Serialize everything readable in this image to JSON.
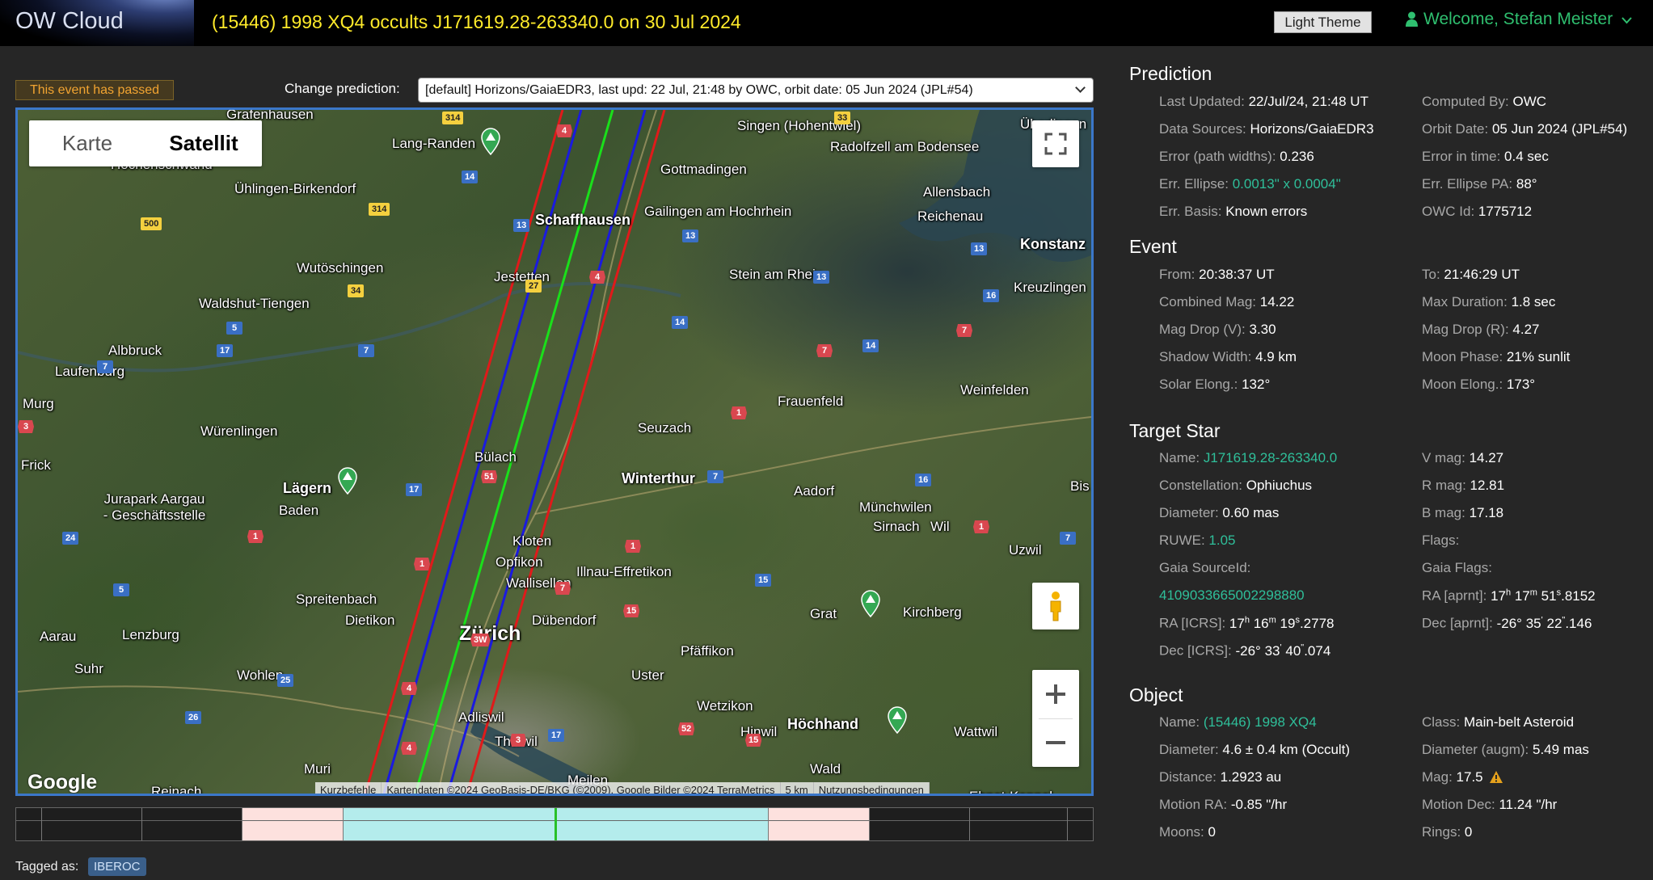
{
  "app": {
    "logo": "OW Cloud",
    "event_title": "(15446) 1998 XQ4 occults J171619.28-263340.0 on 30 Jul 2024",
    "theme_button": "Light Theme",
    "welcome": "Welcome, Stefan Meister"
  },
  "status": {
    "passed": "This event has passed"
  },
  "prediction_select": {
    "label": "Change prediction:",
    "value": "[default] Horizons/GaiaEDR3, last upd: 22 Jul, 21:48 by OWC, orbit date: 05 Jun 2024 (JPL#54)"
  },
  "map": {
    "type_options": [
      "Karte",
      "Satellit"
    ],
    "active_type": "Satellit",
    "google": "Google",
    "attribution": [
      "Kurzbefehle",
      "Kartendaten ©2024 GeoBasis-DE/BKG (©2009), Google Bilder ©2024 TerraMetrics",
      "5 km",
      "Nutzungsbedingungen"
    ],
    "places": [
      "Grafenhausen",
      "Lang-Randen",
      "Singen (Hohentwiel)",
      "Radolfzell am Bodensee",
      "Hochenschwand",
      "Gottmadingen",
      "Ühlingen-Birkendorf",
      "Allensbach",
      "Schaffhausen",
      "Gailingen am Hochrhein",
      "Reichenau",
      "Konstanz",
      "Wutöschingen",
      "Jestetten",
      "Stein am Rhein",
      "Kreuzlingen",
      "Waldshut-Tiengen",
      "Albbruck",
      "Laufenburg",
      "Murg",
      "Frauenfeld",
      "Weinfelden",
      "Seuzach",
      "Würenlingen",
      "Frick",
      "Bülach",
      "Lägern",
      "Winterthur",
      "Aadorf",
      "Münchwilen",
      "Jurapark Aargau - Geschäftsstelle",
      "Baden",
      "Sirnach",
      "Wil",
      "Kloten",
      "Uzwil",
      "Opfikon",
      "Wallisellen",
      "Illnau-Effretikon",
      "Spreitenbach",
      "Dietikon",
      "Dübendorf",
      "Kirchberg",
      "Aarau",
      "Lenzburg",
      "Grat",
      "Zürich",
      "Suhr",
      "Pfäffikon",
      "Wohlen",
      "Uster",
      "Wetzikon",
      "Adliswil",
      "Hinwil",
      "Höchhand",
      "Thalwil",
      "Wattwil",
      "Muri",
      "Reinach",
      "Meilen",
      "Wald",
      "Ebnat-Kappel",
      "Überlingen",
      "Bis"
    ],
    "roads": [
      "314",
      "33",
      "4",
      "14",
      "500",
      "314",
      "13",
      "13",
      "13",
      "27",
      "34",
      "4",
      "13",
      "16",
      "5",
      "14",
      "7",
      "17",
      "7",
      "7",
      "14",
      "7",
      "1",
      "3",
      "16",
      "51",
      "17",
      "7",
      "1",
      "1",
      "24",
      "1",
      "1",
      "15",
      "5",
      "15",
      "3W",
      "7",
      "25",
      "4",
      "26",
      "17",
      "52",
      "15",
      "3",
      "4",
      "7"
    ]
  },
  "timeline": {
    "segments": [
      "dark",
      "dark",
      "pink",
      "cyan",
      "cyan",
      "pink",
      "dark",
      "dark"
    ]
  },
  "tags": {
    "label": "Tagged as:",
    "items": [
      "IBEROC"
    ]
  },
  "prediction": {
    "title": "Prediction",
    "left": [
      {
        "k": "Last Updated:",
        "v": "22/Jul/24, 21:48 UT"
      },
      {
        "k": "Data Sources:",
        "v": "Horizons/GaiaEDR3"
      },
      {
        "k": "Error (path widths):",
        "v": "0.236"
      },
      {
        "k": "Err. Ellipse:",
        "v": "0.0013\" x 0.0004\""
      },
      {
        "k": "Err. Basis:",
        "v": "Known errors"
      }
    ],
    "right": [
      {
        "k": "Computed By:",
        "v": "OWC"
      },
      {
        "k": "Orbit Date:",
        "v": "05 Jun 2024 (JPL#54)"
      },
      {
        "k": "Error in time:",
        "v": "0.4 sec"
      },
      {
        "k": "Err. Ellipse PA:",
        "v": "88°"
      },
      {
        "k": "OWC Id:",
        "v": "1775712"
      }
    ]
  },
  "event": {
    "title": "Event",
    "left": [
      {
        "k": "From:",
        "v": "20:38:37 UT"
      },
      {
        "k": "Combined Mag:",
        "v": "14.22"
      },
      {
        "k": "Mag Drop (V):",
        "v": "3.30"
      },
      {
        "k": "Shadow Width:",
        "v": "4.9 km"
      },
      {
        "k": "Solar Elong.:",
        "v": "132°"
      }
    ],
    "right": [
      {
        "k": "To:",
        "v": "21:46:29 UT"
      },
      {
        "k": "Max Duration:",
        "v": "1.8 sec"
      },
      {
        "k": "Mag Drop (R):",
        "v": "4.27"
      },
      {
        "k": "Moon Phase:",
        "v": "21% sunlit"
      },
      {
        "k": "Moon Elong.:",
        "v": "173°"
      }
    ]
  },
  "target_star": {
    "title": "Target Star",
    "name_k": "Name:",
    "name_v": "J171619.28-263340.0",
    "constellation_k": "Constellation:",
    "constellation_v": "Ophiuchus",
    "diameter_k": "Diameter:",
    "diameter_v": "0.60 mas",
    "ruwe_k": "RUWE:",
    "ruwe_v": "1.05",
    "gaia_k": "Gaia SourceId:",
    "gaia_v": "4109033665002298880",
    "ra_k": "RA [ICRS]:",
    "ra_h": "17",
    "ra_m": "16",
    "ra_s": "19",
    "ra_f": ".2778",
    "dec_k": "Dec [ICRS]:",
    "dec_d": "-26°",
    "dec_m": "33",
    "dec_s": "40",
    "dec_f": ".074",
    "vmag_k": "V mag:",
    "vmag_v": "14.27",
    "rmag_k": "R mag:",
    "rmag_v": "12.81",
    "bmag_k": "B mag:",
    "bmag_v": "17.18",
    "flags_k": "Flags:",
    "gaiaflags_k": "Gaia Flags:",
    "ra2_k": "RA [aprnt]:",
    "ra2_h": "17",
    "ra2_m": "17",
    "ra2_s": "51",
    "ra2_f": ".8152",
    "dec2_k": "Dec [aprnt]:",
    "dec2_d": "-26°",
    "dec2_m": "35",
    "dec2_s": "22",
    "dec2_f": ".146",
    "units": {
      "h": "h",
      "m": "m",
      "s": "s",
      "am": "'",
      "as": "\""
    }
  },
  "object": {
    "title": "Object",
    "left": [
      {
        "k": "Name:",
        "v": "(15446) 1998 XQ4"
      },
      {
        "k": "Diameter:",
        "v": "4.6 ± 0.4 km  (Occult)"
      },
      {
        "k": "Distance:",
        "v": "1.2923 au"
      },
      {
        "k": "Motion RA:",
        "v": "-0.85 \"/hr"
      },
      {
        "k": "Moons:",
        "v": "0"
      }
    ],
    "right": [
      {
        "k": "Class:",
        "v": "Main-belt Asteroid"
      },
      {
        "k": "Diameter (augm):",
        "v": "5.49 mas"
      },
      {
        "k": "Mag:",
        "v": "17.5"
      },
      {
        "k": "Motion Dec:",
        "v": "11.24 \"/hr"
      },
      {
        "k": "Rings:",
        "v": "0"
      }
    ]
  },
  "colors": {
    "accent": "#2fbf9a",
    "title_yellow": "#ffeb2a",
    "welcome_green": "#2fbf6f",
    "path_red": "#e01a1a",
    "path_blue": "#1a1ae0",
    "path_green": "#1ae01a"
  }
}
